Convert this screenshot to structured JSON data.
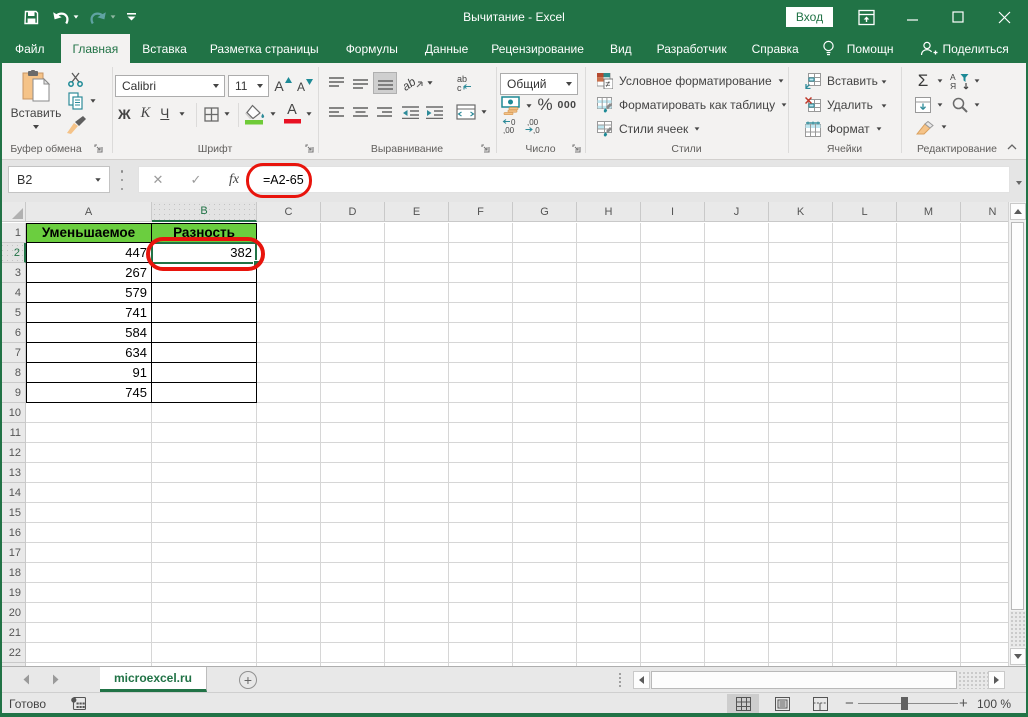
{
  "window": {
    "title": "Вычитание - Excel",
    "sign_in_label": "Вход"
  },
  "tabs": {
    "items": [
      {
        "label": "Файл"
      },
      {
        "label": "Главная",
        "active": true
      },
      {
        "label": "Вставка"
      },
      {
        "label": "Разметка страницы"
      },
      {
        "label": "Формулы"
      },
      {
        "label": "Данные"
      },
      {
        "label": "Рецензирование"
      },
      {
        "label": "Вид"
      },
      {
        "label": "Разработчик"
      },
      {
        "label": "Справка"
      }
    ],
    "tell_me_label": "Помощн",
    "share_label": "Поделиться"
  },
  "ribbon": {
    "clipboard": {
      "label": "Буфер обмена",
      "paste_label": "Вставить"
    },
    "font": {
      "label": "Шрифт",
      "font_name": "Calibri",
      "font_size": "11",
      "bold": "Ж",
      "italic": "К",
      "underline": "Ч",
      "grow": "А",
      "shrink": "А",
      "color_letter": "А"
    },
    "alignment": {
      "label": "Выравнивание"
    },
    "number": {
      "label": "Число",
      "format": "Общий",
      "percent": "%",
      "thousands": "000"
    },
    "styles": {
      "label": "Стили",
      "conditional": "Условное форматирование",
      "format_table": "Форматировать как таблицу",
      "cell_styles": "Стили ячеек"
    },
    "cells": {
      "label": "Ячейки",
      "insert": "Вставить",
      "delete": "Удалить",
      "format": "Формат"
    },
    "editing": {
      "label": "Редактирование",
      "sum": "Σ",
      "sort_a": "А",
      "sort_z": "Я"
    }
  },
  "formula_bar": {
    "name_box": "B2",
    "cancel": "✕",
    "enter": "✓",
    "fx": "fx",
    "formula": "=A2-65"
  },
  "grid": {
    "columns": [
      "A",
      "B",
      "C",
      "D",
      "E",
      "F",
      "G",
      "H",
      "I",
      "J",
      "K",
      "L",
      "M",
      "N"
    ],
    "row_count": 22,
    "selected_column": "B",
    "selected_row": 2,
    "active_cell": "B2",
    "cells": {
      "A1": "Уменьшаемое",
      "B1": "Разность",
      "A2": "447",
      "B2": "382",
      "A3": "267",
      "A4": "579",
      "A5": "741",
      "A6": "584",
      "A7": "634",
      "A8": "91",
      "A9": "745"
    },
    "green_header_cells": [
      "A1",
      "B1"
    ],
    "bordered_columns": [
      "A",
      "B"
    ],
    "bordered_last_row": 9,
    "header_fill": "#6bce3f",
    "selection_color": "#217346"
  },
  "sheet_bar": {
    "tab_label": "microexcel.ru"
  },
  "status_bar": {
    "ready_label": "Готово",
    "zoom_value": "100 %"
  },
  "annotation": {
    "color": "#e8140c"
  }
}
